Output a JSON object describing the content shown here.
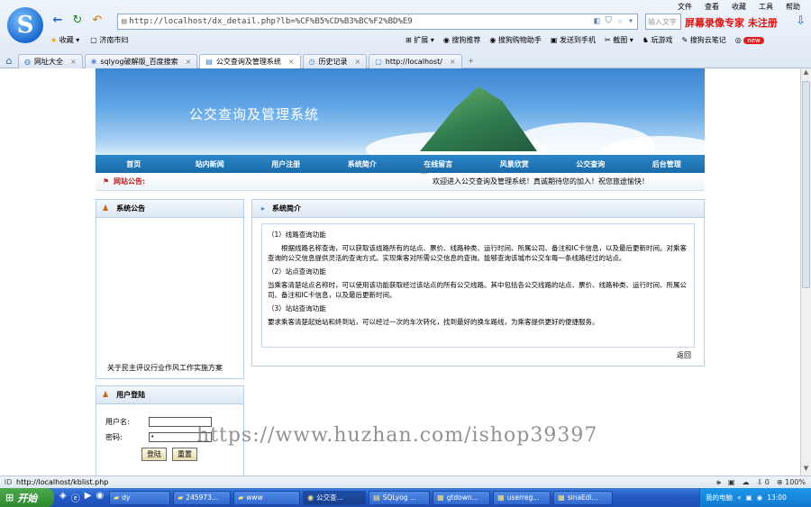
{
  "browser": {
    "menu": [
      "文件",
      "查看",
      "收藏",
      "工具",
      "帮助"
    ],
    "address": "http://localhost/dx_detail.php?lb=%CF%B5%CD%B3%BC%F2%BD%E9",
    "search_placeholder": "输入文字",
    "recorder_text": "屏幕录像专家 未注册",
    "favorites": [
      "收藏",
      "济南市妇"
    ],
    "tools": [
      "扩展",
      "搜狗推荐",
      "搜狗购物助手",
      "发送到手机",
      "截图",
      "玩游戏",
      "搜狗云笔记",
      "new"
    ],
    "tabs": [
      {
        "label": "网址大全",
        "active": false
      },
      {
        "label": "sqlyog破解版_百度搜索",
        "active": false
      },
      {
        "label": "公交查询及管理系统",
        "active": true
      },
      {
        "label": "历史记录",
        "active": false
      },
      {
        "label": "http://localhost/",
        "active": false
      }
    ],
    "status_url": "http://localhost/kblist.php",
    "status_right": [
      "0",
      "100%"
    ]
  },
  "site": {
    "title": "公交查询及管理系统",
    "nav": [
      "首页",
      "站内新闻",
      "用户注册",
      "系统简介",
      "在线留言",
      "风景欣赏",
      "公交查询",
      "后台管理"
    ],
    "notice_label": "网站公告:",
    "notice_text": "欢迎进入公交查询及管理系统！真诚期待您的加入！祝您旅途愉快！",
    "announce": {
      "header": "系统公告",
      "link": "关于民主评议行业作风工作实施方案"
    },
    "login": {
      "header": "用户登陆",
      "user_label": "用户名:",
      "pass_label": "密码:",
      "user_value": "",
      "pass_value": "•",
      "submit": "登陆",
      "reset": "重置"
    },
    "intro": {
      "header": "系统简介",
      "s1_title": "（1）线路查询功能",
      "s1_text": "根据线路名称查询，可以获取该线路所有的站点、票价、线路种类、运行时间、所属公司、备注和IC卡信息，以及最后更新时间。对乘客查询的公交信息提供灵活的查询方式。实现乘客对所需公交信息的查询。能够查询该城市公交车每一条线路经过的站点。",
      "s2_title": "（2）站点查询功能",
      "s2_text": "当乘客清楚站点名称时，可以使用该功能获取经过该站点的所有公交线路。其中包括各公交线路的站点、票价、线路种类、运行时间、所属公司、备注和IC卡信息，以及最后更新时间。",
      "s3_title": "（3）站站查询功能",
      "s3_text": "要求乘客清楚起始站和终到站，可以经过一次的车次转化，找到最好的换车路线，为乘客提供更好的便捷服务。",
      "back": "返回"
    }
  },
  "watermark": "https://www.huzhan.com/ishop39397",
  "taskbar": {
    "start": "开始",
    "tasks": [
      {
        "label": "dy",
        "active": false
      },
      {
        "label": "245973...",
        "active": false
      },
      {
        "label": "www",
        "active": false
      },
      {
        "label": "公交查...",
        "active": true
      },
      {
        "label": "SQLyog ...",
        "active": false
      },
      {
        "label": "gtdown...",
        "active": false
      },
      {
        "label": "userreg...",
        "active": false
      },
      {
        "label": "sinaEdi...",
        "active": false
      }
    ],
    "tray_label": "我的电脑",
    "clock": "13:00"
  }
}
